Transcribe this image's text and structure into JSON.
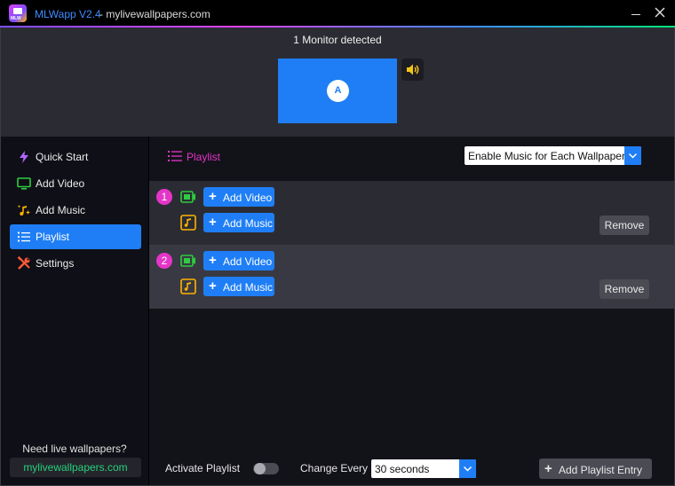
{
  "window": {
    "app_name": "MLWapp V2.4",
    "app_url": " - mylivewallpapers.com",
    "logo_text": "MLW"
  },
  "monitors": {
    "title": "1 Monitor detected",
    "badge": "A"
  },
  "sidebar": {
    "items": [
      {
        "label": "Quick Start",
        "icon": "lightning-icon",
        "color": "#b266ff"
      },
      {
        "label": "Add Video",
        "icon": "monitor-icon",
        "color": "#2ecc40"
      },
      {
        "label": "Add Music",
        "icon": "music-sparkle-icon",
        "color": "#ffb300"
      },
      {
        "label": "Playlist",
        "icon": "list-icon",
        "color": "#ffffff",
        "active": true
      },
      {
        "label": "Settings",
        "icon": "tools-icon",
        "color": "#ff5a36"
      }
    ],
    "promo_text": "Need live wallpapers?",
    "promo_link": "mylivewallpapers.com"
  },
  "main": {
    "title": "Playlist",
    "music_mode": "Enable Music for Each Wallpaper"
  },
  "entries": [
    {
      "number": "1",
      "add_video": "Add Video",
      "add_music": "Add Music",
      "remove": "Remove"
    },
    {
      "number": "2",
      "add_video": "Add Video",
      "add_music": "Add Music",
      "remove": "Remove"
    }
  ],
  "footer": {
    "activate_label": "Activate Playlist",
    "activate_on": false,
    "change_label": "Change Every",
    "interval": "30 seconds",
    "add_entry": "Add Playlist Entry"
  },
  "colors": {
    "accent_blue": "#1f7ef5",
    "accent_pink": "#e535c8",
    "link_green": "#26d07c"
  }
}
